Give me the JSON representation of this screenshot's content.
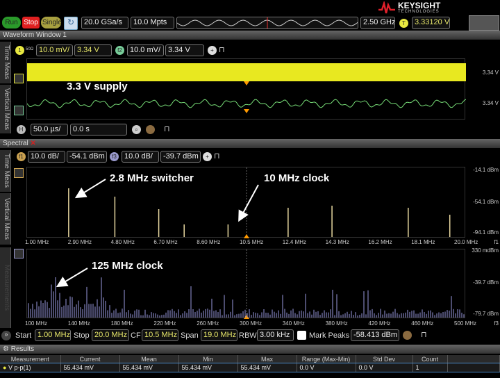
{
  "brand": {
    "name": "KEYSIGHT",
    "sub": "TECHNOLOGIES"
  },
  "toolbar": {
    "run": "Run",
    "stop": "Stop",
    "single": "Single",
    "sample_rate": "20.0 GSa/s",
    "memory": "10.0 Mpts",
    "bandwidth": "2.50 GHz",
    "trigger_label": "T",
    "trigger_level": "3.33120 V"
  },
  "waveform_window": {
    "title": "Waveform Window 1",
    "ch1": {
      "badge": "1",
      "tag": "50Ω",
      "scale": "10.0 mV/",
      "offset": "3.34 V"
    },
    "f2": {
      "badge": "f2",
      "scale": "10.0 mV/",
      "offset": "3.34 V"
    },
    "right_labels": [
      "3.34 V",
      "3.34 V"
    ],
    "annotation": "3.3 V supply",
    "horizontal": {
      "badge": "H",
      "scale": "50.0 µs/",
      "position": "0.0 s"
    },
    "side_tabs": [
      "Time Meas",
      "Vertical Meas"
    ]
  },
  "spectral": {
    "title": "Spectral",
    "f1": {
      "badge": "f1",
      "scale": "10.0 dB/",
      "offset": "-54.1 dBm"
    },
    "f3": {
      "badge": "f3",
      "scale": "10.0 dB/",
      "offset": "-39.7 dBm"
    },
    "side_tabs": [
      "Time Meas",
      "Vertical Meas",
      "Measurements"
    ],
    "plot1": {
      "x_ticks": [
        "1.00 MHz",
        "2.90 MHz",
        "4.80 MHz",
        "6.70 MHz",
        "8.60 MHz",
        "10.5 MHz",
        "12.4 MHz",
        "14.3 MHz",
        "16.2 MHz",
        "18.1 MHz",
        "20.0 MHz"
      ],
      "y_labels": [
        "-14.1 dBm",
        "-54.1 dBm",
        "-94.1 dBm"
      ],
      "trace": "f1",
      "peaks_mhz": [
        2.8,
        4.8,
        6.7,
        7.8,
        9.7,
        12.3,
        14.2,
        17.5,
        19.3
      ],
      "annotations": [
        "2.8 MHz switcher",
        "10 MHz clock"
      ]
    },
    "plot2": {
      "x_ticks": [
        "100 MHz",
        "140 MHz",
        "180 MHz",
        "220 MHz",
        "260 MHz",
        "300 MHz",
        "340 MHz",
        "380 MHz",
        "420 MHz",
        "460 MHz",
        "500 MHz"
      ],
      "y_labels": [
        "330 mdBm",
        "-39.7 dBm",
        "-79.7 dBm"
      ],
      "trace": "f3",
      "annotation": "125 MHz clock"
    },
    "controls": {
      "start_label": "Start",
      "start": "1.00 MHz",
      "stop_label": "Stop",
      "stop": "20.0 MHz",
      "cf_label": "CF",
      "cf": "10.5 MHz",
      "span_label": "Span",
      "span": "19.0 MHz",
      "rbw_label": "RBW",
      "rbw": "3.00 kHz",
      "mark_peaks": "Mark Peaks",
      "mark_peaks_checked": false,
      "threshold": "-58.413 dBm"
    }
  },
  "results": {
    "title": "Results",
    "columns": [
      "Measurement",
      "Current",
      "Mean",
      "Min",
      "Max",
      "Range (Max-Min)",
      "Std Dev",
      "Count"
    ],
    "rows": [
      [
        "V p-p(1)",
        "55.434 mV",
        "55.434 mV",
        "55.434 mV",
        "55.434 mV",
        "0.0 V",
        "0.0 V",
        "1"
      ]
    ]
  }
}
